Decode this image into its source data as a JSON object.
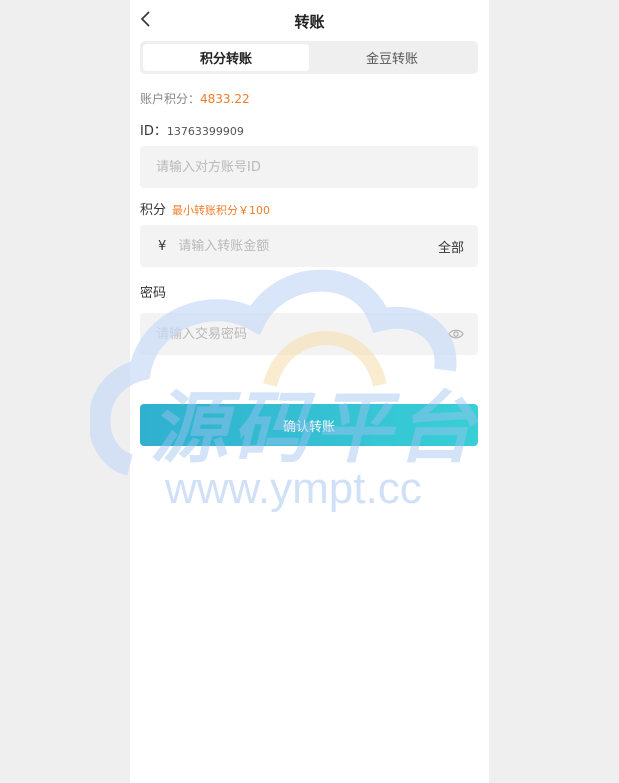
{
  "header": {
    "title": "转账"
  },
  "tabs": [
    {
      "label": "积分转账",
      "active": true
    },
    {
      "label": "金豆转账",
      "active": false
    }
  ],
  "account": {
    "balance_label": "账户积分：",
    "balance_value": "4833.22",
    "id_label": "ID：",
    "id_value": "13763399909"
  },
  "recipient": {
    "placeholder": "请输入对方账号ID",
    "value": ""
  },
  "amount": {
    "label": "积分",
    "min_note": "最小转账积分￥100",
    "currency_symbol": "¥",
    "placeholder": "请输入转账金额",
    "all_button": "全部",
    "value": ""
  },
  "password": {
    "label": "密码",
    "placeholder": "请输入交易密码",
    "value": ""
  },
  "submit": {
    "label": "确认转账"
  },
  "watermark": {
    "text": "源码平台",
    "url": "www.ympt.cc"
  },
  "colors": {
    "accent_orange": "#f07c2a",
    "button_start": "#30b0cf",
    "button_end": "#38cfd6",
    "page_bg": "#efefef"
  },
  "icons": {
    "back": "chevron-left-icon",
    "eye": "eye-icon"
  }
}
